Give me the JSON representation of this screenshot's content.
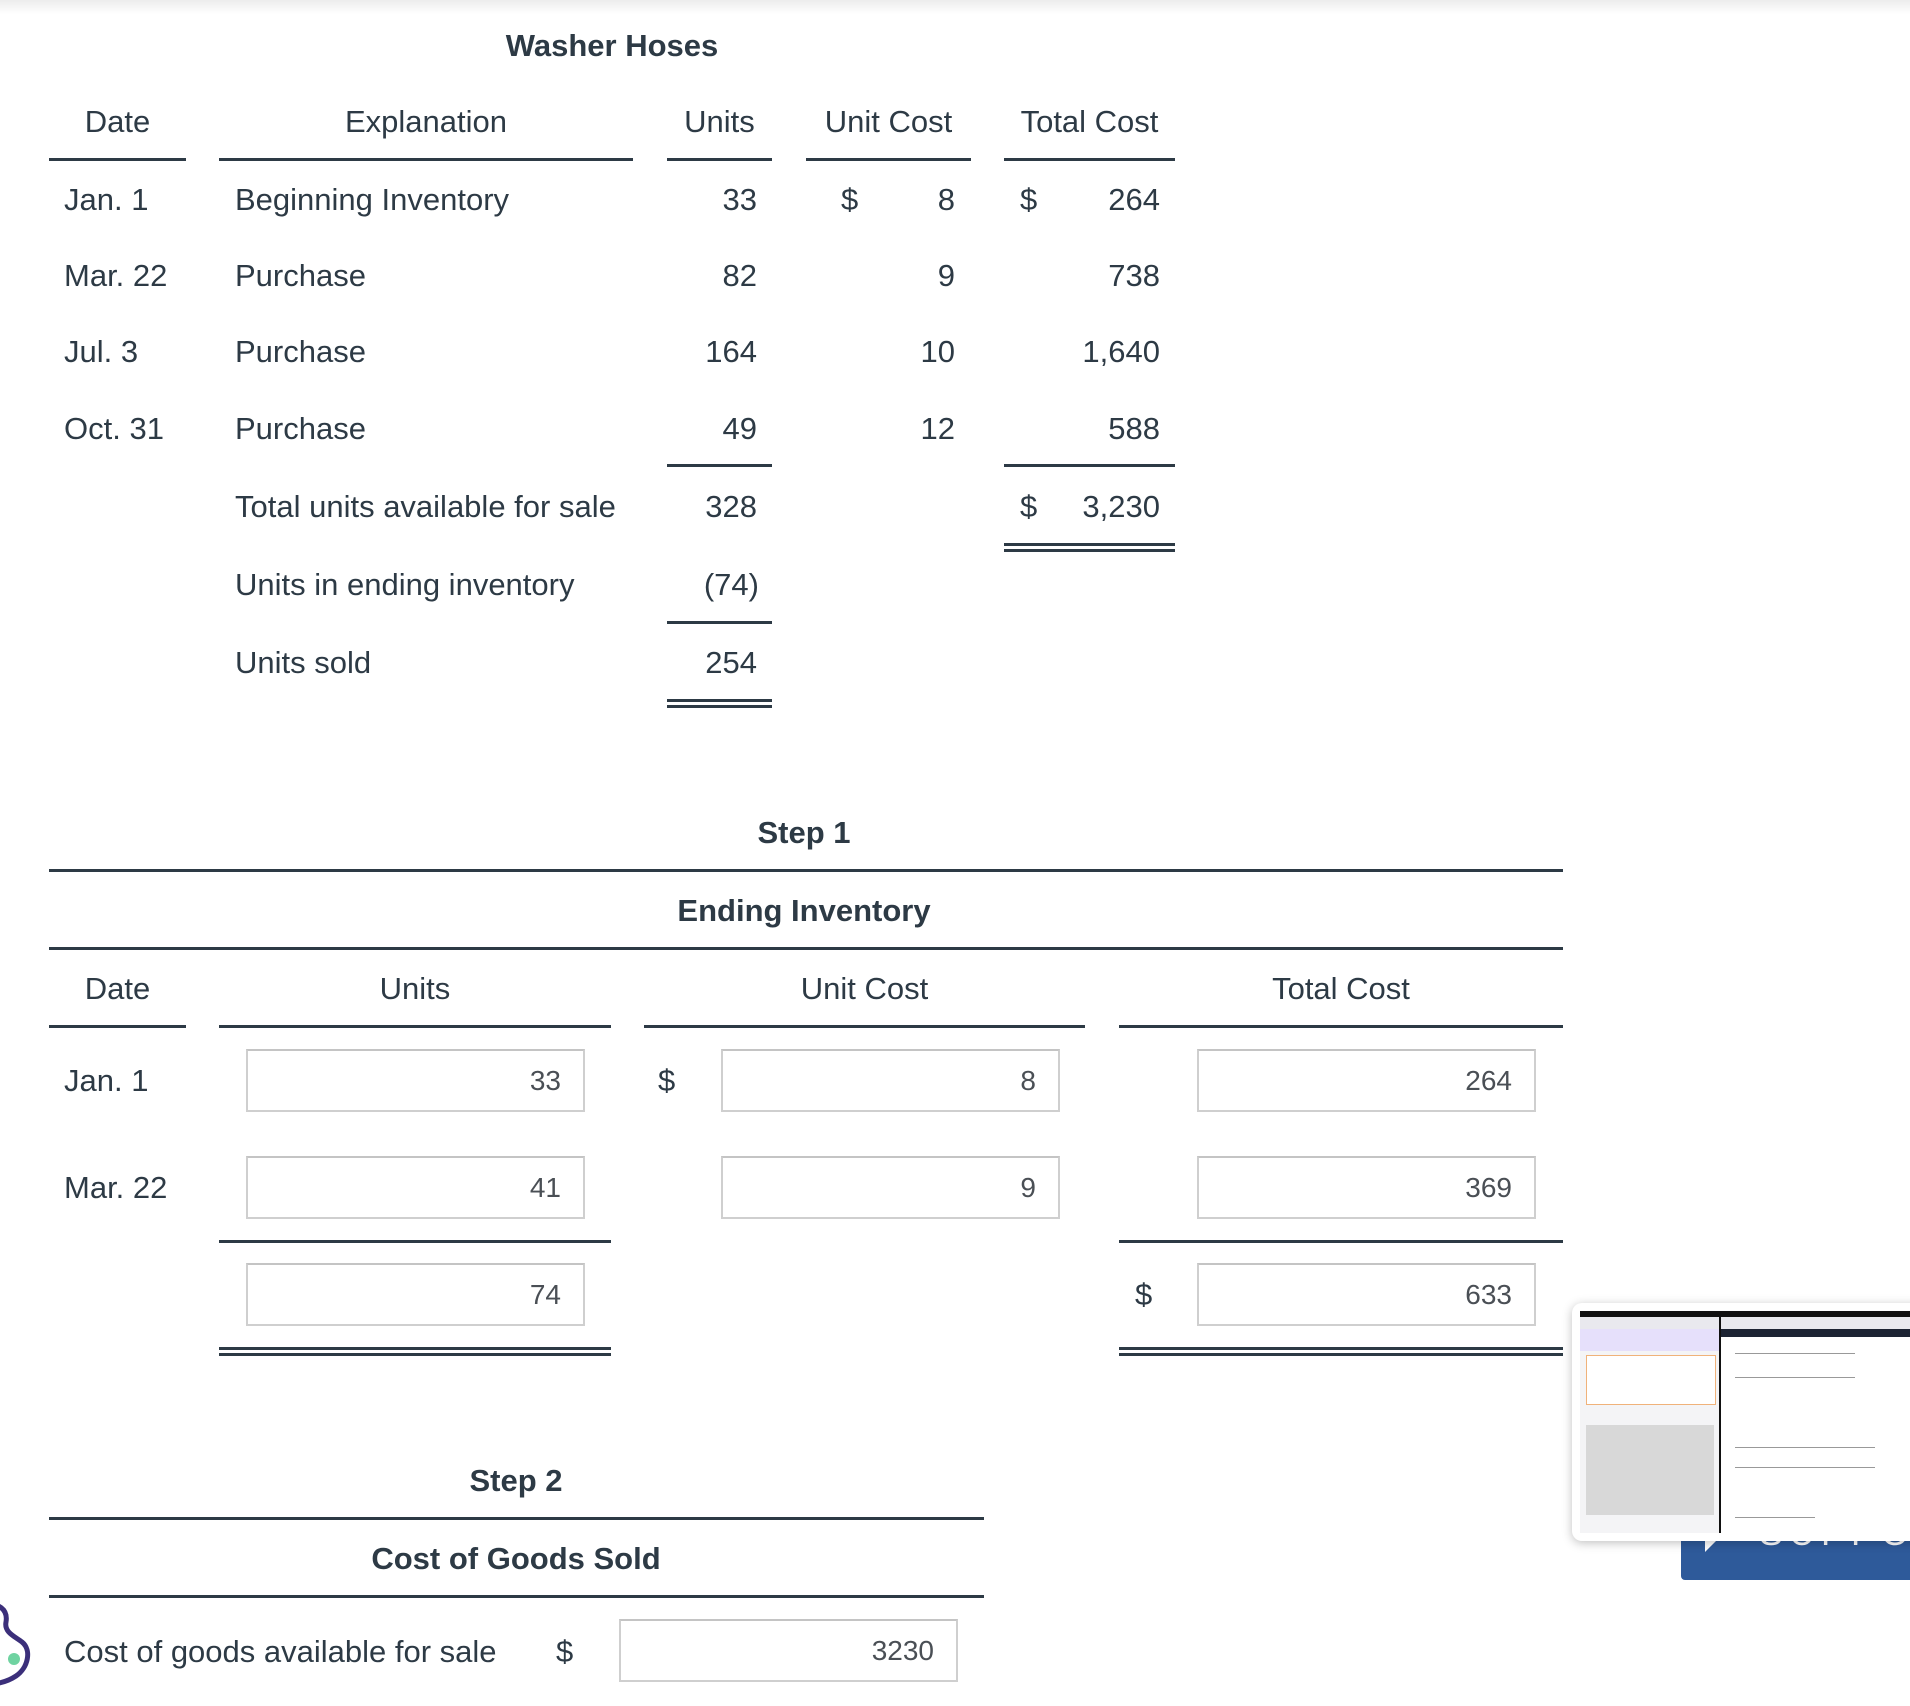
{
  "inventory_table": {
    "title": "Washer Hoses",
    "headers": {
      "date": "Date",
      "explanation": "Explanation",
      "units": "Units",
      "unit_cost": "Unit Cost",
      "total_cost": "Total Cost"
    },
    "rows": [
      {
        "date": "Jan. 1",
        "explanation": "Beginning Inventory",
        "units": "33",
        "unit_cost_prefix": "$",
        "unit_cost": "8",
        "total_cost_prefix": "$",
        "total_cost": "264"
      },
      {
        "date": "Mar. 22",
        "explanation": "Purchase",
        "units": "82",
        "unit_cost_prefix": "",
        "unit_cost": "9",
        "total_cost_prefix": "",
        "total_cost": "738"
      },
      {
        "date": "Jul. 3",
        "explanation": "Purchase",
        "units": "164",
        "unit_cost_prefix": "",
        "unit_cost": "10",
        "total_cost_prefix": "",
        "total_cost": "1,640"
      },
      {
        "date": "Oct. 31",
        "explanation": "Purchase",
        "units": "49",
        "unit_cost_prefix": "",
        "unit_cost": "12",
        "total_cost_prefix": "",
        "total_cost": "588"
      }
    ],
    "total_available": {
      "label": "Total units available for sale",
      "units": "328",
      "total_cost_prefix": "$",
      "total_cost": "3,230"
    },
    "ending_units": {
      "label": "Units in ending inventory",
      "units": "(74)"
    },
    "units_sold": {
      "label": "Units sold",
      "units": "254"
    }
  },
  "step1": {
    "step_label": "Step 1",
    "title": "Ending Inventory",
    "headers": {
      "date": "Date",
      "units": "Units",
      "unit_cost": "Unit Cost",
      "total_cost": "Total Cost"
    },
    "rows": [
      {
        "date": "Jan. 1",
        "units": "33",
        "unit_cost_prefix": "$",
        "unit_cost": "8",
        "total_cost": "264"
      },
      {
        "date": "Mar. 22",
        "units": "41",
        "unit_cost_prefix": "",
        "unit_cost": "9",
        "total_cost": "369"
      }
    ],
    "totals": {
      "units": "74",
      "total_cost_prefix": "$",
      "total_cost": "633"
    }
  },
  "step2": {
    "step_label": "Step 2",
    "title": "Cost of Goods Sold",
    "rows": [
      {
        "label": "Cost of goods available for sale",
        "prefix": "$",
        "value": "3230"
      }
    ]
  },
  "overlay": {
    "support_label": "SUPPORT",
    "thumbnail_label": "Screenshot preview"
  },
  "colors": {
    "text": "#2d3a45",
    "support": "#2e5a9a",
    "chat_icon": "#3b2f7a",
    "chat_dot": "#6fd3a1"
  }
}
